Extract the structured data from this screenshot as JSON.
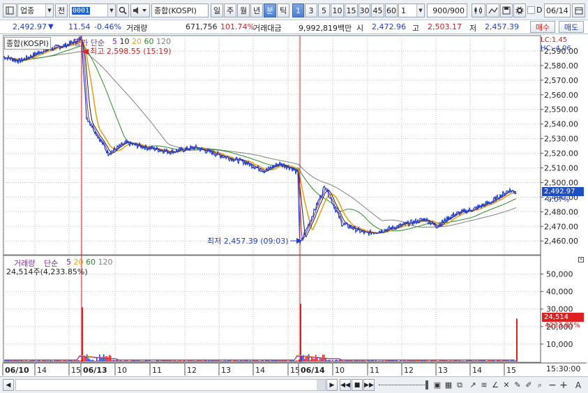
{
  "toolbar": {
    "market_select": "업종",
    "prev_label": "전",
    "code_value": "0001",
    "index_name": "종합(KOSPI)",
    "periods": [
      "일",
      "주",
      "월",
      "년",
      "분",
      "틱"
    ],
    "active_period": "분",
    "intervals": [
      "1",
      "3",
      "5",
      "10",
      "15",
      "30",
      "45",
      "60"
    ],
    "active_interval": "1",
    "interval_select": "1",
    "count_value": "900",
    "count_max": "/900",
    "date_checkbox_label": "D",
    "date_value": "06/14"
  },
  "quote": {
    "price": "2,492.97",
    "change_arrow": "▼",
    "change": "11.54",
    "change_pct": "-0.46%",
    "volume_label": "거래량",
    "volume": "671,756",
    "volume_ratio": "101.74%",
    "amount_label": "거래대금",
    "amount": "9,992,819백만",
    "open_label": "시",
    "open": "2,472.96",
    "high_label": "고",
    "high": "2,503.17",
    "low_label": "저",
    "low": "2,457.39",
    "buy_label": "매수",
    "sell_label": "매도"
  },
  "price_panel": {
    "title": "종합(KOSPI)",
    "ma_title": "종가 단순",
    "ma_periods": [
      "5",
      "10",
      "20",
      "60",
      "120"
    ],
    "ma_colors": [
      "#7d2f9e",
      "#222222",
      "#e8a020",
      "#2a8a2a",
      "#808080"
    ],
    "price_color": "#1e3fd0",
    "axis_labels": [
      "2,590.00",
      "2,580.00",
      "2,570.00",
      "2,560.00",
      "2,550.00",
      "2,540.00",
      "2,530.00",
      "2,520.00",
      "2,510.00",
      "2,500.00",
      "2,490.00",
      "2,480.00",
      "2,470.00",
      "2,460.00"
    ],
    "lc_label": "LC:1.45",
    "hc_label": "HC:-4.06",
    "current_price_tag": "2,492.97",
    "current_pct_tag": "-0.07%",
    "high_annotation": "최고 2,598.55 (15:19)",
    "low_annotation": "최저 2,457.39 (09:03)"
  },
  "volume_panel": {
    "title": "거래량",
    "ma_title": "단순",
    "ma_periods": [
      "5",
      "20",
      "60",
      "120"
    ],
    "current_value": "24,514주(4,233.85%)",
    "axis_labels": [
      "50,000",
      "40,000",
      "30,000",
      "20,000",
      "10,000"
    ],
    "current_tag": "24,514",
    "current_pct_tag": "4233.85%"
  },
  "x_axis": {
    "labels": [
      "06/10",
      "14",
      "15",
      "06/13",
      "10",
      "11",
      "12",
      "13",
      "14",
      "15",
      "06/14",
      "10",
      "11",
      "12",
      "13",
      "14",
      "15"
    ],
    "date_labels": [
      "06/10",
      "06/13",
      "06/14"
    ],
    "time_readout": "15:30:00"
  },
  "chart_data": {
    "type": "line",
    "title": "종합(KOSPI)",
    "series": [
      {
        "name": "종합(KOSPI)",
        "values": [
          2586,
          2583,
          2590,
          2594,
          2598.55,
          2545,
          2520,
          2527,
          2524,
          2521,
          2524,
          2518,
          2514,
          2508,
          2513,
          2510,
          2506,
          2457.39,
          2498,
          2472,
          2465,
          2468,
          2472,
          2475,
          2470,
          2478,
          2482,
          2487,
          2495,
          2492.97
        ]
      }
    ],
    "x": [
      "06/10 13:00",
      "06/10 14:00",
      "06/10 15:00",
      "06/10 15:10",
      "06/10 15:19",
      "06/13 09:30",
      "06/13 10:00",
      "06/13 10:30",
      "06/13 11:00",
      "06/13 12:00",
      "06/13 12:30",
      "06/13 13:00",
      "06/13 13:30",
      "06/13 14:00",
      "06/13 14:30",
      "06/13 15:00",
      "06/13 15:20",
      "06/14 09:03",
      "06/14 09:45",
      "06/14 10:30",
      "06/14 11:00",
      "06/14 11:30",
      "06/14 12:00",
      "06/14 12:30",
      "06/14 13:00",
      "06/14 13:30",
      "06/14 14:00",
      "06/14 14:30",
      "06/14 15:00",
      "06/14 15:20"
    ],
    "ylim": [
      2452,
      2600
    ],
    "volume": {
      "name": "거래량",
      "spikes": [
        {
          "x": "06/10 15:20",
          "value": 31000
        },
        {
          "x": "06/13 09:00",
          "value": 5000
        },
        {
          "x": "06/13 15:20",
          "value": 33000
        },
        {
          "x": "06/14 09:00",
          "value": 6000
        },
        {
          "x": "06/14 15:20",
          "value": 24514
        }
      ],
      "ylim": [
        0,
        55000
      ]
    }
  }
}
